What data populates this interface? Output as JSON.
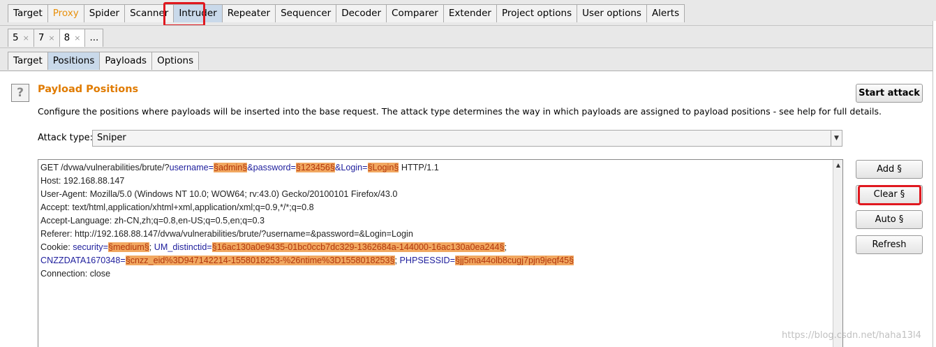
{
  "top_tabs": [
    {
      "label": "Target"
    },
    {
      "label": "Proxy"
    },
    {
      "label": "Spider"
    },
    {
      "label": "Scanner"
    },
    {
      "label": "Intruder",
      "active": true
    },
    {
      "label": "Repeater"
    },
    {
      "label": "Sequencer"
    },
    {
      "label": "Decoder"
    },
    {
      "label": "Comparer"
    },
    {
      "label": "Extender"
    },
    {
      "label": "Project options"
    },
    {
      "label": "User options"
    },
    {
      "label": "Alerts"
    }
  ],
  "request_tabs": [
    {
      "label": "5",
      "close": "×"
    },
    {
      "label": "7",
      "close": "×"
    },
    {
      "label": "8",
      "close": "×",
      "active": true
    },
    {
      "label": "..."
    }
  ],
  "sub_tabs": [
    {
      "label": "Target"
    },
    {
      "label": "Positions",
      "active": true
    },
    {
      "label": "Payloads"
    },
    {
      "label": "Options"
    }
  ],
  "panel": {
    "help_icon": "?",
    "title": "Payload Positions",
    "description": "Configure the positions where payloads will be inserted into the base request. The attack type determines the way in which payloads are assigned to payload positions - see help for full details.",
    "attack_type_label": "Attack type:",
    "attack_type_value": "Sniper"
  },
  "buttons": {
    "start_attack": "Start attack",
    "add": "Add §",
    "clear": "Clear §",
    "auto": "Auto §",
    "refresh": "Refresh"
  },
  "request": {
    "line1": {
      "a": "GET /dvwa/vulnerabilities/brute/?",
      "p1_name": "username=",
      "p1_value": "§admin§",
      "p2_name": "&password=",
      "p2_value": "§123456§",
      "p3_name": "&Login=",
      "p3_value": "§Login§",
      "b": " HTTP/1.1"
    },
    "line2": "Host: 192.168.88.147",
    "line3": "User-Agent: Mozilla/5.0 (Windows NT 10.0; WOW64; rv:43.0) Gecko/20100101 Firefox/43.0",
    "line4": "Accept: text/html,application/xhtml+xml,application/xml;q=0.9,*/*;q=0.8",
    "line5": "Accept-Language: zh-CN,zh;q=0.8,en-US;q=0.5,en;q=0.3",
    "line6": "Referer: http://192.168.88.147/dvwa/vulnerabilities/brute/?username=&password=&Login=Login",
    "line7": {
      "a": "Cookie: ",
      "c1_name": "security=",
      "c1_value": "§medium§",
      "sep1": "; ",
      "c2_name": "UM_distinctid=",
      "c2_value": "§16ac130a0e9435-01bc0ccb7dc329-1362684a-144000-16ac130a0ea244§",
      "sep2": ";"
    },
    "line8": {
      "c3_name": "CNZZDATA1670348=",
      "c3_value": "§cnzz_eid%3D947142214-1558018253-%26ntime%3D1558018253§",
      "sep3": "; ",
      "c4_name": "PHPSESSID=",
      "c4_value": "§jj5ma44olb8cugj7pjn9jeqf45§"
    },
    "line9": "Connection: close"
  },
  "watermark": "https://blog.csdn.net/haha13l4",
  "colors": {
    "accent_orange": "#e07b00",
    "highlight_red": "#e0181f",
    "payload_bg": "#f1a861",
    "param_blue": "#1d1d9c"
  }
}
